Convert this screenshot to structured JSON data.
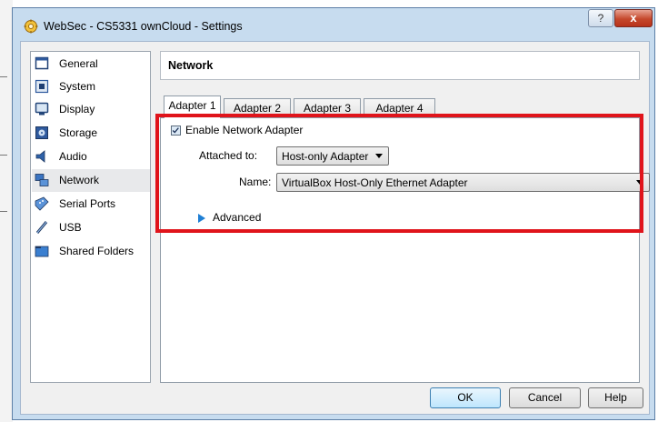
{
  "window": {
    "title": "WebSec - CS5331 ownCloud - Settings",
    "help_glyph": "?",
    "close_glyph": "x"
  },
  "sidebar": {
    "items": [
      {
        "label": "General",
        "icon": "general-icon"
      },
      {
        "label": "System",
        "icon": "system-chip-icon"
      },
      {
        "label": "Display",
        "icon": "display-monitor-icon"
      },
      {
        "label": "Storage",
        "icon": "storage-disk-icon"
      },
      {
        "label": "Audio",
        "icon": "audio-speaker-icon"
      },
      {
        "label": "Network",
        "icon": "network-icon"
      },
      {
        "label": "Serial Ports",
        "icon": "serial-port-icon"
      },
      {
        "label": "USB",
        "icon": "usb-plug-icon"
      },
      {
        "label": "Shared Folders",
        "icon": "folder-icon"
      }
    ],
    "selected": "Network",
    "hovered": "Storage"
  },
  "page": {
    "title": "Network"
  },
  "tabs": [
    {
      "label": "Adapter 1",
      "active": true
    },
    {
      "label": "Adapter 2",
      "active": false
    },
    {
      "label": "Adapter 3",
      "active": false
    },
    {
      "label": "Adapter 4",
      "active": false
    }
  ],
  "adapter": {
    "enable_label": "Enable Network Adapter",
    "enabled": true,
    "attached_label": "Attached to:",
    "attached_value": "Host-only Adapter",
    "name_label": "Name:",
    "name_value": "VirtualBox Host-Only Ethernet Adapter",
    "advanced_label": "Advanced"
  },
  "buttons": {
    "ok": "OK",
    "cancel": "Cancel",
    "help": "Help"
  },
  "colors": {
    "highlight_box": "#e0141b",
    "window_frame": "#c7dcef",
    "close_button": "#c5482c"
  }
}
